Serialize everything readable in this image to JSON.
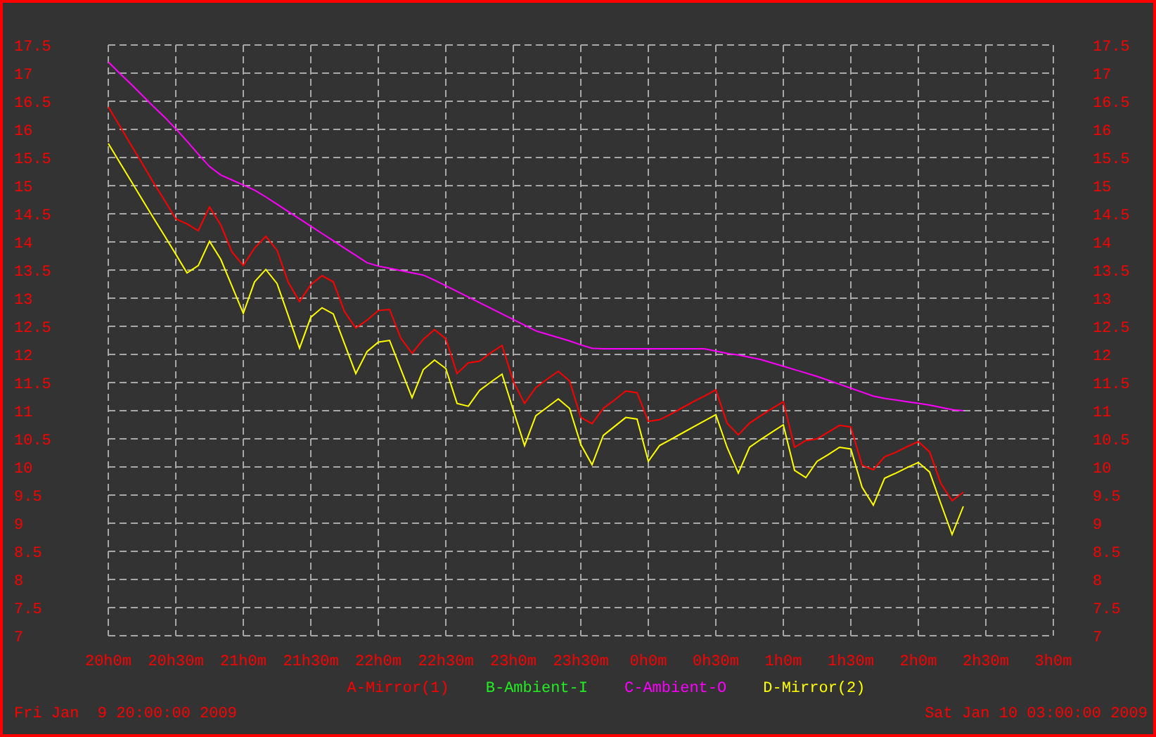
{
  "chart_data": {
    "type": "line",
    "categories": [
      "20h0m",
      null,
      null,
      null,
      null,
      null,
      "20h30m",
      null,
      null,
      null,
      null,
      null,
      "21h0m",
      null,
      null,
      null,
      null,
      null,
      "21h30m",
      null,
      null,
      null,
      null,
      null,
      "22h0m",
      null,
      null,
      null,
      null,
      null,
      "22h30m",
      null,
      null,
      null,
      null,
      null,
      "23h0m",
      null,
      null,
      null,
      null,
      null,
      "23h30m",
      null,
      null,
      null,
      null,
      null,
      "0h0m",
      null,
      null,
      null,
      null,
      null,
      "0h30m",
      null,
      null,
      null,
      null,
      null,
      "1h0m",
      null,
      null,
      null,
      null,
      null,
      "1h30m",
      null,
      null,
      null,
      null,
      null,
      "2h0m",
      null,
      null,
      null,
      null,
      null,
      "2h30m",
      null,
      null,
      null,
      null,
      null,
      "3h0m"
    ],
    "series": [
      {
        "name": "A-Mirror(1)",
        "color": "#ff0000",
        "values": [
          16.4,
          16.07,
          15.73,
          15.4,
          15.06,
          14.74,
          14.41,
          14.32,
          14.2,
          14.62,
          14.3,
          13.82,
          13.58,
          13.89,
          14.1,
          13.85,
          13.28,
          12.94,
          13.24,
          13.4,
          13.29,
          12.76,
          12.47,
          12.61,
          12.78,
          12.8,
          12.29,
          12.02,
          12.27,
          12.44,
          12.28,
          11.66,
          11.85,
          11.88,
          12.03,
          12.16,
          11.52,
          11.13,
          11.41,
          11.56,
          11.7,
          11.53,
          10.88,
          10.77,
          11.04,
          11.19,
          11.35,
          11.32,
          10.81,
          10.84,
          10.94,
          11.05,
          11.16,
          11.26,
          11.37,
          10.78,
          10.57,
          10.78,
          10.91,
          11.04,
          11.16,
          10.35,
          10.47,
          10.5,
          10.62,
          10.74,
          10.71,
          10.03,
          9.95,
          10.18,
          10.26,
          10.36,
          10.45,
          10.27,
          9.71,
          9.4,
          9.55,
          null,
          null,
          null,
          null,
          null,
          null,
          null,
          null
        ]
      },
      {
        "name": "B-Ambient-I",
        "color": "#22ee22",
        "values": [
          null,
          null,
          null,
          null,
          null,
          null,
          null,
          null,
          null,
          null,
          null,
          null,
          null,
          null,
          null,
          null,
          null,
          null,
          null,
          null,
          null,
          null,
          null,
          null,
          null,
          null,
          null,
          null,
          null,
          null,
          null,
          null,
          null,
          null,
          null,
          null,
          null,
          null,
          null,
          null,
          null,
          null,
          null,
          null,
          null,
          null,
          null,
          null,
          null,
          null,
          null,
          null,
          null,
          null,
          null,
          null,
          null,
          null,
          null,
          null,
          null,
          null,
          null,
          null,
          null,
          null,
          null,
          null,
          null,
          null,
          null,
          null,
          null,
          null,
          null,
          null,
          null,
          null,
          null,
          null,
          null,
          null,
          null,
          null,
          null
        ]
      },
      {
        "name": "C-Ambient-O",
        "color": "#ff00ff",
        "values": [
          17.2,
          17.0,
          16.81,
          16.61,
          16.41,
          16.22,
          16.01,
          15.79,
          15.56,
          15.34,
          15.19,
          15.1,
          15.01,
          14.92,
          14.8,
          14.67,
          14.54,
          14.41,
          14.28,
          14.15,
          14.02,
          13.89,
          13.76,
          13.63,
          13.57,
          13.53,
          13.49,
          13.45,
          13.41,
          13.32,
          13.22,
          13.12,
          13.02,
          12.92,
          12.82,
          12.72,
          12.62,
          12.52,
          12.42,
          12.36,
          12.3,
          12.24,
          12.17,
          12.11,
          12.1,
          12.1,
          12.1,
          12.1,
          12.1,
          12.1,
          12.1,
          12.1,
          12.1,
          12.1,
          12.06,
          12.02,
          11.99,
          11.95,
          11.91,
          11.85,
          11.79,
          11.73,
          11.67,
          11.61,
          11.54,
          11.47,
          11.4,
          11.33,
          11.26,
          11.22,
          11.19,
          11.16,
          11.13,
          11.1,
          11.06,
          11.02,
          11.0,
          null,
          null,
          null,
          null,
          null,
          null,
          null,
          null
        ]
      },
      {
        "name": "D-Mirror(2)",
        "color": "#ffff00",
        "values": [
          15.75,
          15.42,
          15.09,
          14.76,
          14.43,
          14.11,
          13.78,
          13.45,
          13.58,
          14.01,
          13.69,
          13.21,
          12.73,
          13.29,
          13.51,
          13.26,
          12.69,
          12.11,
          12.66,
          12.83,
          12.72,
          12.19,
          11.66,
          12.05,
          12.22,
          12.25,
          11.74,
          11.23,
          11.73,
          11.9,
          11.75,
          11.13,
          11.08,
          11.36,
          11.51,
          11.65,
          11.01,
          10.38,
          10.91,
          11.06,
          11.21,
          11.04,
          10.4,
          10.04,
          10.56,
          10.72,
          10.88,
          10.85,
          10.1,
          10.38,
          10.49,
          10.6,
          10.71,
          10.82,
          10.93,
          10.35,
          9.89,
          10.35,
          10.49,
          10.62,
          10.75,
          9.94,
          9.81,
          10.1,
          10.22,
          10.35,
          10.32,
          9.64,
          9.32,
          9.8,
          9.89,
          9.99,
          10.08,
          9.91,
          9.35,
          8.8,
          9.3,
          null,
          null,
          null,
          null,
          null,
          null,
          null,
          null
        ]
      }
    ],
    "ylim": [
      7,
      17.5
    ],
    "grid": true,
    "yticks": [
      17.5,
      17,
      16.5,
      16,
      15.5,
      15,
      14.5,
      14,
      13.5,
      13,
      12.5,
      12,
      11.5,
      11,
      10.5,
      10,
      9.5,
      9,
      8.5,
      8,
      7.5,
      7
    ]
  },
  "left_axis": {
    "labels": [
      "17.5",
      "17",
      "16.5",
      "16",
      "15.5",
      "15",
      "14.5",
      "14",
      "13.5",
      "13",
      "12.5",
      "12",
      "11.5",
      "11",
      "10.5",
      "10",
      "9.5",
      "9",
      "8.5",
      "8",
      "7.5",
      "7"
    ]
  },
  "right_axis": {
    "labels": [
      "17.5",
      "17",
      "16.5",
      "16",
      "15.5",
      "15",
      "14.5",
      "14",
      "13.5",
      "13",
      "12.5",
      "12",
      "11.5",
      "11",
      "10.5",
      "10",
      "9.5",
      "9",
      "8.5",
      "8",
      "7.5",
      "7"
    ]
  },
  "start_time": "Fri Jan  9 20:00:00 2009",
  "end_time": "Sat Jan 10 03:00:00 2009"
}
